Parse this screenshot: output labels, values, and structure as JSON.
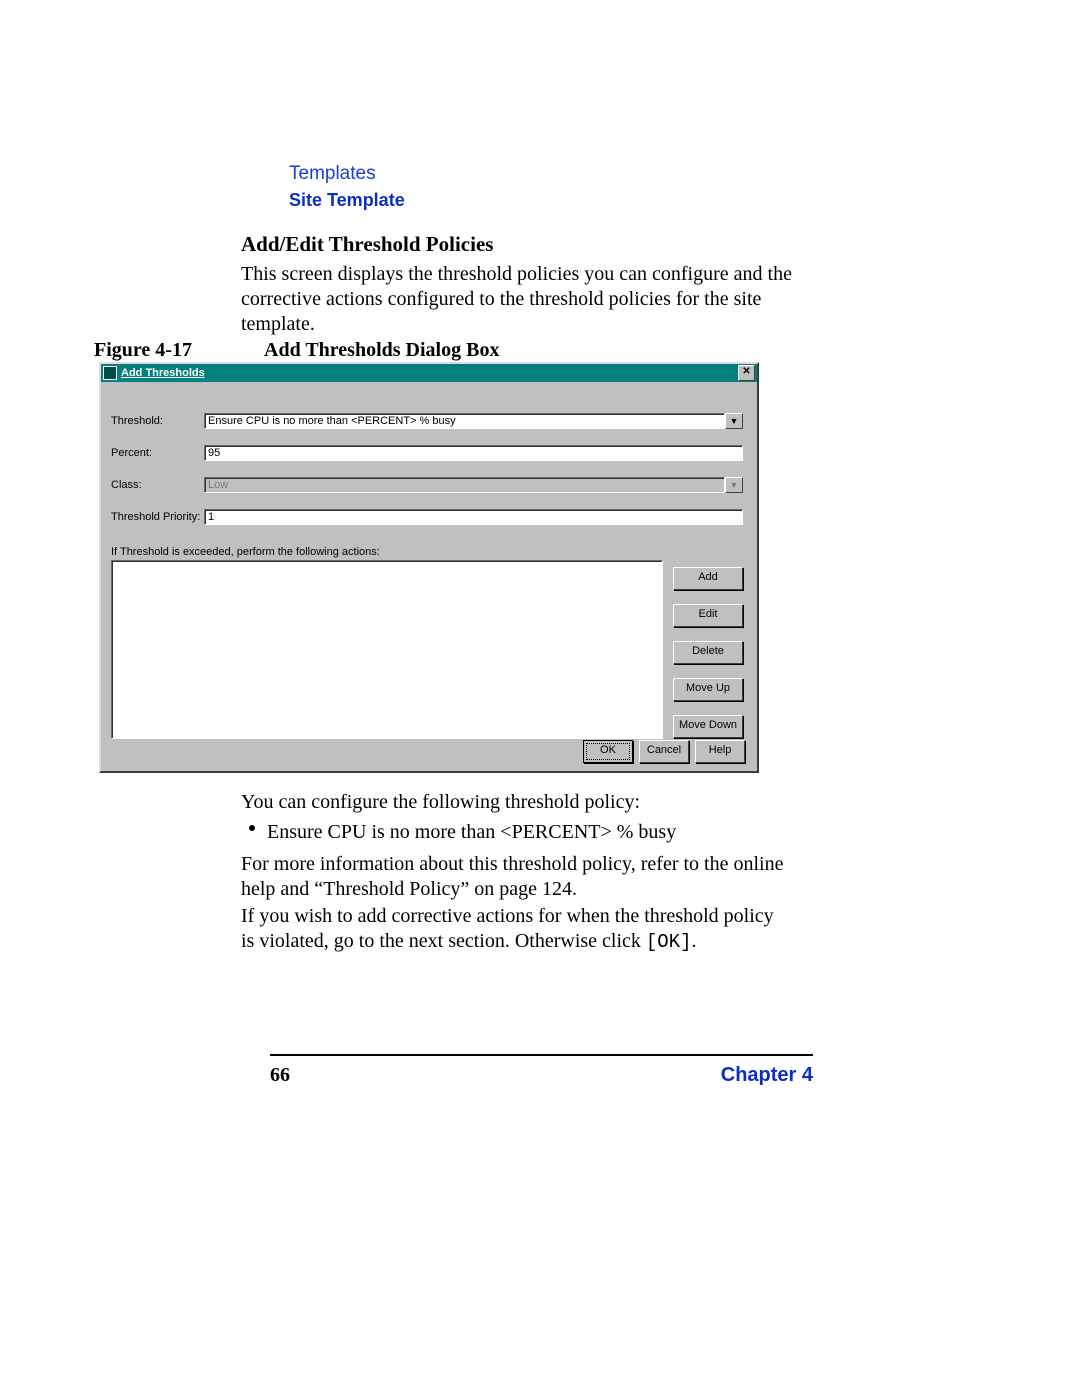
{
  "header": {
    "templates_link": "Templates",
    "site_template": "Site Template"
  },
  "section": {
    "heading": "Add/Edit Threshold Policies",
    "intro": "This screen displays the threshold policies you can configure and the corrective actions configured to the threshold policies for the site template."
  },
  "figure": {
    "label": "Figure 4-17",
    "title": "Add Thresholds Dialog Box"
  },
  "dialog": {
    "title": "Add Thresholds",
    "close_glyph": "✕",
    "labels": {
      "threshold": "Threshold:",
      "percent": "Percent:",
      "class": "Class:",
      "priority": "Threshold Priority:",
      "actions": "If Threshold is exceeded, perform the following actions:"
    },
    "values": {
      "threshold": "Ensure CPU is no more than <PERCENT> % busy",
      "percent": "95",
      "class": "Low",
      "priority": "1"
    },
    "dropdown_glyph": "▼",
    "buttons": {
      "add": "Add",
      "edit": "Edit",
      "delete": "Delete",
      "move_up": "Move Up",
      "move_down": "Move Down",
      "ok": "OK",
      "cancel": "Cancel",
      "help": "Help"
    }
  },
  "body": {
    "p1": "You can configure the following threshold policy:",
    "bullet": "Ensure CPU is no more than <PERCENT> % busy",
    "p2": "For more information about this threshold policy, refer to the online help and “Threshold Policy” on page 124.",
    "p3_a": "If you wish to add corrective actions for when the threshold policy is violated, go to the next section. Otherwise click ",
    "p3_code": "[OK]",
    "p3_b": "."
  },
  "footer": {
    "page": "66",
    "chapter": "Chapter 4"
  }
}
